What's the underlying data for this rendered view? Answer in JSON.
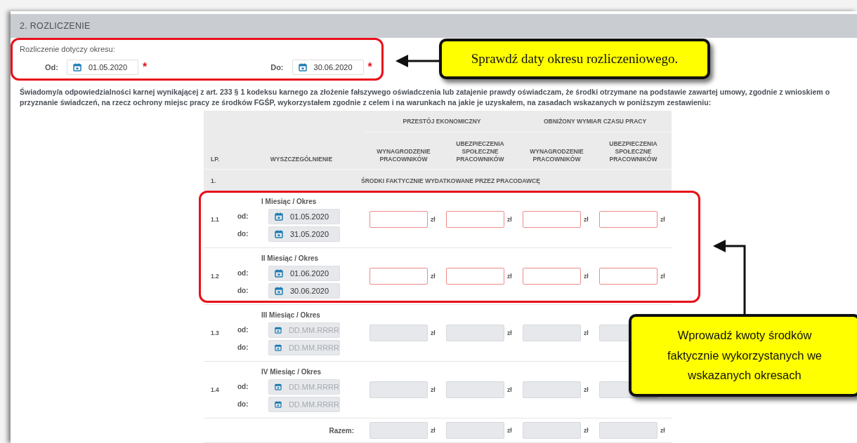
{
  "section": {
    "title": "2. ROZLICZENIE"
  },
  "period": {
    "label": "Rozliczenie dotyczy okresu:",
    "fields": [
      {
        "label": "Od:",
        "value": "01.05.2020",
        "required_mark": "*"
      },
      {
        "label": "Do:",
        "value": "30.06.2020",
        "required_mark": "*"
      }
    ]
  },
  "declaration": "Świadomy/a odpowiedzialności karnej wynikającej z art. 233 § 1 kodeksu karnego za złożenie fałszywego oświadczenia lub zatajenie prawdy oświadczam, że środki otrzymane na podstawie zawartej umowy, zgodnie z wnioskiem o przyznanie świadczeń, na rzecz ochrony miejsc pracy ze środków FGŚP, wykorzystałem zgodnie z celem i na warunkach na jakie je uzyskałem, na zasadach wskazanych w poniższym zestawieniu:",
  "table": {
    "lp_header": "LP.",
    "item_header": "WYSZCZEGÓLNIENIE",
    "groups": [
      {
        "title": "PRZESTÓJ EKONOMICZNY",
        "columns": [
          "WYNAGRODZENIE PRACOWNIKÓW",
          "UBEZPIECZENIA SPOŁECZNE PRACOWNIKÓW"
        ]
      },
      {
        "title": "OBNIŻONY WYMIAR CZASU PRACY",
        "columns": [
          "WYNAGRODZENIE PRACOWNIKÓW",
          "UBEZPIECZENIA SPOŁECZNE PRACOWNIKÓW"
        ]
      }
    ],
    "section_row": {
      "lp": "1.",
      "title": "ŚRODKI FAKTYCZNIE WYDATKOWANE PRZEZ PRACODAWCĘ"
    },
    "rows": [
      {
        "lp": "1.1",
        "title": "I Miesiąc / Okres",
        "dates": [
          {
            "label": "od:",
            "value": "01.05.2020"
          },
          {
            "label": "do:",
            "value": "31.05.2020"
          }
        ],
        "amounts": [
          {
            "disabled": false,
            "unit": "zł"
          },
          {
            "disabled": false,
            "unit": "zł"
          },
          {
            "disabled": false,
            "unit": "zł"
          },
          {
            "disabled": false,
            "unit": "zł"
          }
        ]
      },
      {
        "lp": "1.2",
        "title": "II Miesiąc / Okres",
        "dates": [
          {
            "label": "od:",
            "value": "01.06.2020"
          },
          {
            "label": "do:",
            "value": "30.06.2020"
          }
        ],
        "amounts": [
          {
            "disabled": false,
            "unit": "zł"
          },
          {
            "disabled": false,
            "unit": "zł"
          },
          {
            "disabled": false,
            "unit": "zł"
          },
          {
            "disabled": false,
            "unit": "zł"
          }
        ]
      },
      {
        "lp": "1.3",
        "title": "III Miesiąc / Okres",
        "dates": [
          {
            "label": "od:",
            "placeholder": "DD.MM.RRRR"
          },
          {
            "label": "do:",
            "placeholder": "DD.MM.RRRR"
          }
        ],
        "amounts": [
          {
            "disabled": true,
            "unit": "zł"
          },
          {
            "disabled": true,
            "unit": "zł"
          },
          {
            "disabled": true,
            "unit": "zł"
          },
          {
            "disabled": true
          }
        ]
      },
      {
        "lp": "1.4",
        "title": "IV Miesiąc / Okres",
        "dates": [
          {
            "label": "od:",
            "placeholder": "DD.MM.RRRR"
          },
          {
            "label": "do:",
            "placeholder": "DD.MM.RRRR"
          }
        ],
        "amounts": [
          {
            "disabled": true,
            "unit": "zł"
          },
          {
            "disabled": true,
            "unit": "zł"
          },
          {
            "disabled": true,
            "unit": "zł"
          },
          {
            "disabled": true
          }
        ]
      }
    ],
    "total": {
      "label": "Razem:",
      "amounts": [
        {
          "disabled": true,
          "unit": "zł"
        },
        {
          "disabled": true,
          "unit": "zł"
        },
        {
          "disabled": true,
          "unit": "zł"
        },
        {
          "disabled": true,
          "unit": "zł"
        }
      ]
    }
  },
  "callouts": [
    {
      "text": "Sprawdź daty okresu rozliczeniowego.",
      "kind": "serif"
    },
    {
      "text": "Wprowadź kwoty środków faktycznie wykorzystanych we wskazanych okresach",
      "kind": "sans"
    }
  ]
}
